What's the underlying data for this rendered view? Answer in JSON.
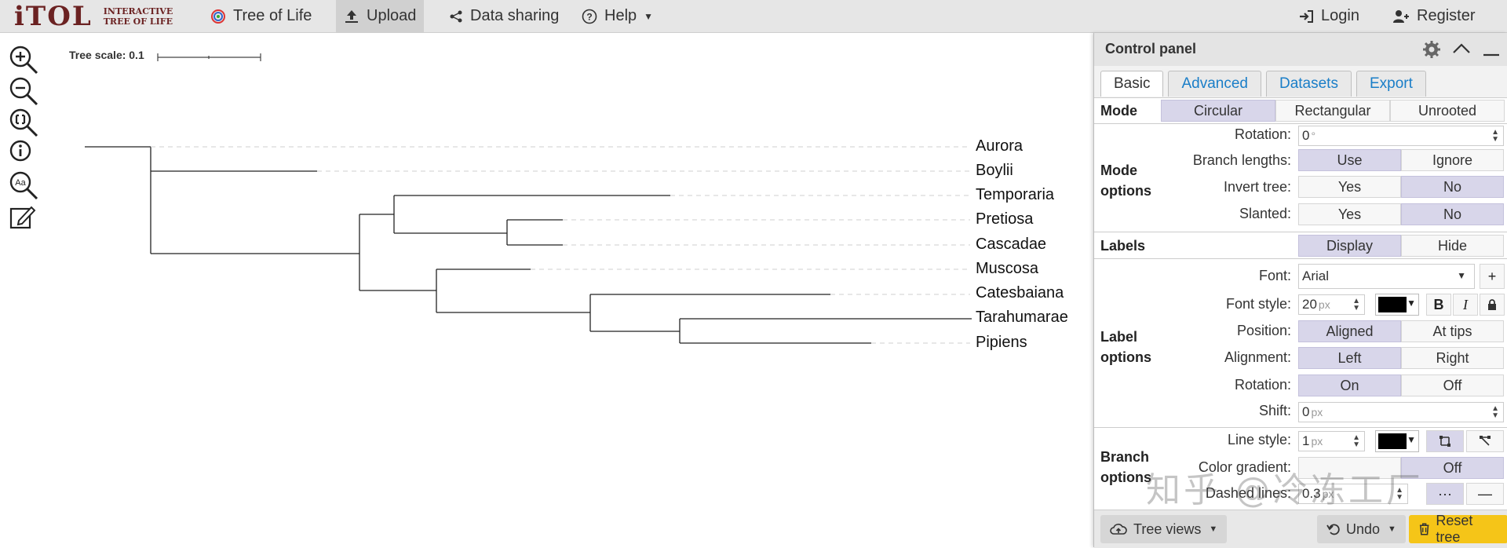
{
  "brand": {
    "name": "iTOL",
    "subtitle_line1": "Interactive",
    "subtitle_line2": "Tree Of Life"
  },
  "nav": {
    "tree_of_life": "Tree of Life",
    "upload": "Upload",
    "data_sharing": "Data sharing",
    "help": "Help",
    "login": "Login",
    "register": "Register"
  },
  "tree": {
    "scale_label": "Tree scale: 0.1",
    "leaves": [
      "Aurora",
      "Boylii",
      "Temporaria",
      "Pretiosa",
      "Cascadae",
      "Muscosa",
      "Catesbaiana",
      "Tarahumarae",
      "Pipiens"
    ]
  },
  "panel": {
    "title": "Control panel",
    "tabs": [
      "Basic",
      "Advanced",
      "Datasets",
      "Export"
    ],
    "mode": {
      "label": "Mode",
      "options": [
        "Circular",
        "Rectangular",
        "Unrooted"
      ],
      "selected": "Circular"
    },
    "mode_options": {
      "label_line1": "Mode",
      "label_line2": "options",
      "rotation_label": "Rotation:",
      "rotation_value": "0",
      "rotation_unit": "°",
      "branch_lengths_label": "Branch lengths:",
      "branch_lengths": [
        "Use",
        "Ignore"
      ],
      "invert_label": "Invert tree:",
      "invert": [
        "Yes",
        "No"
      ],
      "slanted_label": "Slanted:",
      "slanted": [
        "Yes",
        "No"
      ]
    },
    "labels": {
      "label": "Labels",
      "options": [
        "Display",
        "Hide"
      ]
    },
    "label_options": {
      "label_line1": "Label",
      "label_line2": "options",
      "font_label": "Font:",
      "font_value": "Arial",
      "font_style_label": "Font style:",
      "font_size": "20",
      "font_unit": "px",
      "bold": "B",
      "italic": "I",
      "position_label": "Position:",
      "position": [
        "Aligned",
        "At tips"
      ],
      "alignment_label": "Alignment:",
      "alignment": [
        "Left",
        "Right"
      ],
      "rotation_label": "Rotation:",
      "rotation": [
        "On",
        "Off"
      ],
      "shift_label": "Shift:",
      "shift_value": "0",
      "shift_unit": "px"
    },
    "branch_options": {
      "label_line1": "Branch",
      "label_line2": "options",
      "line_style_label": "Line style:",
      "line_width": "1",
      "line_unit": "px",
      "color_gradient_label": "Color gradient:",
      "color_gradient_off": "Off",
      "dashed_label": "Dashed lines:",
      "dashed_value": "0.3",
      "dashed_unit": "px"
    },
    "bottom": {
      "tree_views": "Tree views",
      "undo": "Undo",
      "reset": "Reset tree"
    }
  },
  "watermark": "知乎 @冷冻工厂",
  "colors": {
    "brand": "#6b2222",
    "tab_link": "#1a7ec8",
    "selected": "#d8d6ea",
    "reset": "#f5c518"
  }
}
